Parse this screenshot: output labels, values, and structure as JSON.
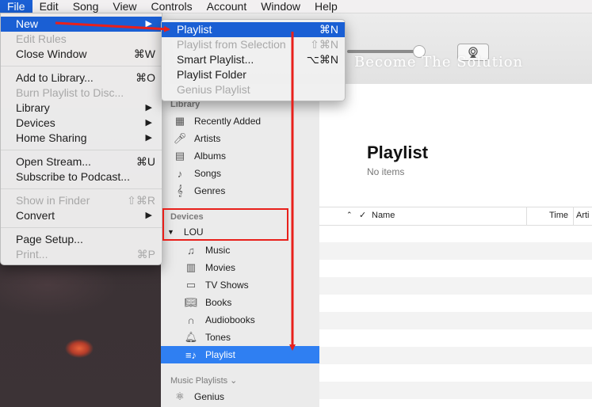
{
  "menubar": [
    "File",
    "Edit",
    "Song",
    "View",
    "Controls",
    "Account",
    "Window",
    "Help"
  ],
  "file_menu": [
    {
      "label": "New",
      "shortcut": "",
      "submenu": true,
      "disabled": false,
      "highlight": true
    },
    {
      "label": "Edit Rules",
      "shortcut": "",
      "submenu": false,
      "disabled": true
    },
    {
      "label": "Close Window",
      "shortcut": "⌘W",
      "submenu": false,
      "disabled": false
    },
    {
      "label": "Add to Library...",
      "shortcut": "⌘O",
      "submenu": false,
      "disabled": false
    },
    {
      "label": "Burn Playlist to Disc...",
      "shortcut": "",
      "submenu": false,
      "disabled": true
    },
    {
      "label": "Library",
      "shortcut": "",
      "submenu": true,
      "disabled": false
    },
    {
      "label": "Devices",
      "shortcut": "",
      "submenu": true,
      "disabled": false
    },
    {
      "label": "Home Sharing",
      "shortcut": "",
      "submenu": true,
      "disabled": false
    },
    {
      "label": "Open Stream...",
      "shortcut": "⌘U",
      "submenu": false,
      "disabled": false
    },
    {
      "label": "Subscribe to Podcast...",
      "shortcut": "",
      "submenu": false,
      "disabled": false
    },
    {
      "label": "Show in Finder",
      "shortcut": "⇧⌘R",
      "submenu": false,
      "disabled": true
    },
    {
      "label": "Convert",
      "shortcut": "",
      "submenu": true,
      "disabled": false
    },
    {
      "label": "Page Setup...",
      "shortcut": "",
      "submenu": false,
      "disabled": false
    },
    {
      "label": "Print...",
      "shortcut": "⌘P",
      "submenu": false,
      "disabled": true
    }
  ],
  "new_submenu": [
    {
      "label": "Playlist",
      "shortcut": "⌘N",
      "disabled": false,
      "highlight": true
    },
    {
      "label": "Playlist from Selection",
      "shortcut": "⇧⌘N",
      "disabled": true
    },
    {
      "label": "Smart Playlist...",
      "shortcut": "⌥⌘N",
      "disabled": false
    },
    {
      "label": "Playlist Folder",
      "shortcut": "",
      "disabled": false
    },
    {
      "label": "Genius Playlist",
      "shortcut": "",
      "disabled": true
    }
  ],
  "toolbar": {
    "watermark": "Become The Solution"
  },
  "sidebar": {
    "library_header": "Library",
    "library_items": [
      {
        "label": "Recently Added",
        "icon": "grid-icon"
      },
      {
        "label": "Artists",
        "icon": "microphone-icon"
      },
      {
        "label": "Albums",
        "icon": "album-icon"
      },
      {
        "label": "Songs",
        "icon": "music-note-icon"
      },
      {
        "label": "Genres",
        "icon": "guitar-icon"
      }
    ],
    "devices_header": "Devices",
    "device_name": "LOU",
    "device_items": [
      {
        "label": "Music",
        "icon": "music-note-icon"
      },
      {
        "label": "Movies",
        "icon": "film-icon"
      },
      {
        "label": "TV Shows",
        "icon": "tv-icon"
      },
      {
        "label": "Books",
        "icon": "book-icon"
      },
      {
        "label": "Audiobooks",
        "icon": "headphones-icon"
      },
      {
        "label": "Tones",
        "icon": "bell-icon"
      },
      {
        "label": "Playlist",
        "icon": "playlist-icon",
        "selected": true
      }
    ],
    "music_playlists_header": "Music Playlists ⌄",
    "genius_label": "Genius"
  },
  "content": {
    "title": "Playlist",
    "subtitle": "No items",
    "columns": {
      "check": "✓",
      "name": "Name",
      "time": "Time",
      "artist": "Arti"
    }
  },
  "colors": {
    "accent": "#1a5fd4",
    "selection": "#2f7ff2",
    "annotation": "#e8201b"
  }
}
